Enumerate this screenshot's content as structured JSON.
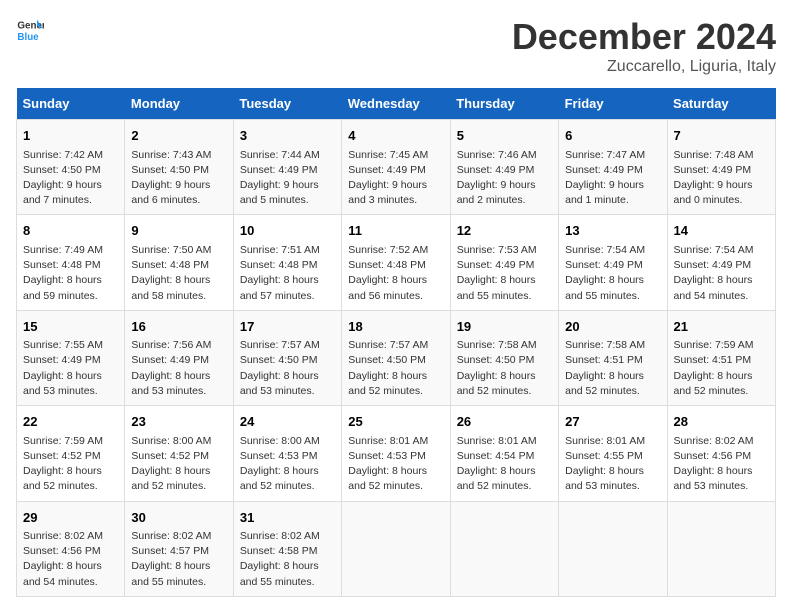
{
  "header": {
    "logo": {
      "line1": "General",
      "line2": "Blue"
    },
    "title": "December 2024",
    "subtitle": "Zuccarello, Liguria, Italy"
  },
  "days_of_week": [
    "Sunday",
    "Monday",
    "Tuesday",
    "Wednesday",
    "Thursday",
    "Friday",
    "Saturday"
  ],
  "weeks": [
    [
      {
        "day": 1,
        "sunrise": "7:42 AM",
        "sunset": "4:50 PM",
        "daylight": "9 hours and 7 minutes."
      },
      {
        "day": 2,
        "sunrise": "7:43 AM",
        "sunset": "4:50 PM",
        "daylight": "9 hours and 6 minutes."
      },
      {
        "day": 3,
        "sunrise": "7:44 AM",
        "sunset": "4:49 PM",
        "daylight": "9 hours and 5 minutes."
      },
      {
        "day": 4,
        "sunrise": "7:45 AM",
        "sunset": "4:49 PM",
        "daylight": "9 hours and 3 minutes."
      },
      {
        "day": 5,
        "sunrise": "7:46 AM",
        "sunset": "4:49 PM",
        "daylight": "9 hours and 2 minutes."
      },
      {
        "day": 6,
        "sunrise": "7:47 AM",
        "sunset": "4:49 PM",
        "daylight": "9 hours and 1 minute."
      },
      {
        "day": 7,
        "sunrise": "7:48 AM",
        "sunset": "4:49 PM",
        "daylight": "9 hours and 0 minutes."
      }
    ],
    [
      {
        "day": 8,
        "sunrise": "7:49 AM",
        "sunset": "4:48 PM",
        "daylight": "8 hours and 59 minutes."
      },
      {
        "day": 9,
        "sunrise": "7:50 AM",
        "sunset": "4:48 PM",
        "daylight": "8 hours and 58 minutes."
      },
      {
        "day": 10,
        "sunrise": "7:51 AM",
        "sunset": "4:48 PM",
        "daylight": "8 hours and 57 minutes."
      },
      {
        "day": 11,
        "sunrise": "7:52 AM",
        "sunset": "4:48 PM",
        "daylight": "8 hours and 56 minutes."
      },
      {
        "day": 12,
        "sunrise": "7:53 AM",
        "sunset": "4:49 PM",
        "daylight": "8 hours and 55 minutes."
      },
      {
        "day": 13,
        "sunrise": "7:54 AM",
        "sunset": "4:49 PM",
        "daylight": "8 hours and 55 minutes."
      },
      {
        "day": 14,
        "sunrise": "7:54 AM",
        "sunset": "4:49 PM",
        "daylight": "8 hours and 54 minutes."
      }
    ],
    [
      {
        "day": 15,
        "sunrise": "7:55 AM",
        "sunset": "4:49 PM",
        "daylight": "8 hours and 53 minutes."
      },
      {
        "day": 16,
        "sunrise": "7:56 AM",
        "sunset": "4:49 PM",
        "daylight": "8 hours and 53 minutes."
      },
      {
        "day": 17,
        "sunrise": "7:57 AM",
        "sunset": "4:50 PM",
        "daylight": "8 hours and 53 minutes."
      },
      {
        "day": 18,
        "sunrise": "7:57 AM",
        "sunset": "4:50 PM",
        "daylight": "8 hours and 52 minutes."
      },
      {
        "day": 19,
        "sunrise": "7:58 AM",
        "sunset": "4:50 PM",
        "daylight": "8 hours and 52 minutes."
      },
      {
        "day": 20,
        "sunrise": "7:58 AM",
        "sunset": "4:51 PM",
        "daylight": "8 hours and 52 minutes."
      },
      {
        "day": 21,
        "sunrise": "7:59 AM",
        "sunset": "4:51 PM",
        "daylight": "8 hours and 52 minutes."
      }
    ],
    [
      {
        "day": 22,
        "sunrise": "7:59 AM",
        "sunset": "4:52 PM",
        "daylight": "8 hours and 52 minutes."
      },
      {
        "day": 23,
        "sunrise": "8:00 AM",
        "sunset": "4:52 PM",
        "daylight": "8 hours and 52 minutes."
      },
      {
        "day": 24,
        "sunrise": "8:00 AM",
        "sunset": "4:53 PM",
        "daylight": "8 hours and 52 minutes."
      },
      {
        "day": 25,
        "sunrise": "8:01 AM",
        "sunset": "4:53 PM",
        "daylight": "8 hours and 52 minutes."
      },
      {
        "day": 26,
        "sunrise": "8:01 AM",
        "sunset": "4:54 PM",
        "daylight": "8 hours and 52 minutes."
      },
      {
        "day": 27,
        "sunrise": "8:01 AM",
        "sunset": "4:55 PM",
        "daylight": "8 hours and 53 minutes."
      },
      {
        "day": 28,
        "sunrise": "8:02 AM",
        "sunset": "4:56 PM",
        "daylight": "8 hours and 53 minutes."
      }
    ],
    [
      {
        "day": 29,
        "sunrise": "8:02 AM",
        "sunset": "4:56 PM",
        "daylight": "8 hours and 54 minutes."
      },
      {
        "day": 30,
        "sunrise": "8:02 AM",
        "sunset": "4:57 PM",
        "daylight": "8 hours and 55 minutes."
      },
      {
        "day": 31,
        "sunrise": "8:02 AM",
        "sunset": "4:58 PM",
        "daylight": "8 hours and 55 minutes."
      },
      null,
      null,
      null,
      null
    ]
  ],
  "labels": {
    "sunrise": "Sunrise:",
    "sunset": "Sunset:",
    "daylight": "Daylight:"
  }
}
